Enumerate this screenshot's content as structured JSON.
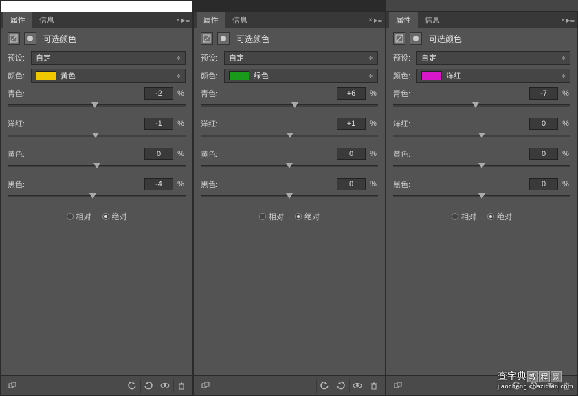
{
  "tabs": {
    "properties": "属性",
    "info": "信息"
  },
  "header": {
    "title": "可选颜色"
  },
  "preset": {
    "label": "预设:",
    "value": "自定"
  },
  "color": {
    "label": "颜色:"
  },
  "sliders": {
    "cyan": "青色:",
    "magenta": "洋红:",
    "yellow": "黄色:",
    "black": "黑色:",
    "pct": "%"
  },
  "mode": {
    "relative": "相对",
    "absolute": "绝对"
  },
  "panels": [
    {
      "white_bar": true,
      "color_value": "黄色",
      "swatch": "#f0c800",
      "cyan": "-2",
      "magenta": "-1",
      "yellow": "0",
      "black": "-4"
    },
    {
      "white_bar": false,
      "color_value": "绿色",
      "swatch": "#1a9a1a",
      "cyan": "+6",
      "magenta": "+1",
      "yellow": "0",
      "black": "0"
    },
    {
      "white_bar": false,
      "color_value": "洋红",
      "swatch": "#d818c8",
      "cyan": "-7",
      "magenta": "0",
      "yellow": "0",
      "black": "0"
    }
  ],
  "watermark": {
    "main": "查字典",
    "tag1": "教",
    "tag2": "程",
    "tag3": "网",
    "url": "jiaocheng.chazidian.com"
  }
}
